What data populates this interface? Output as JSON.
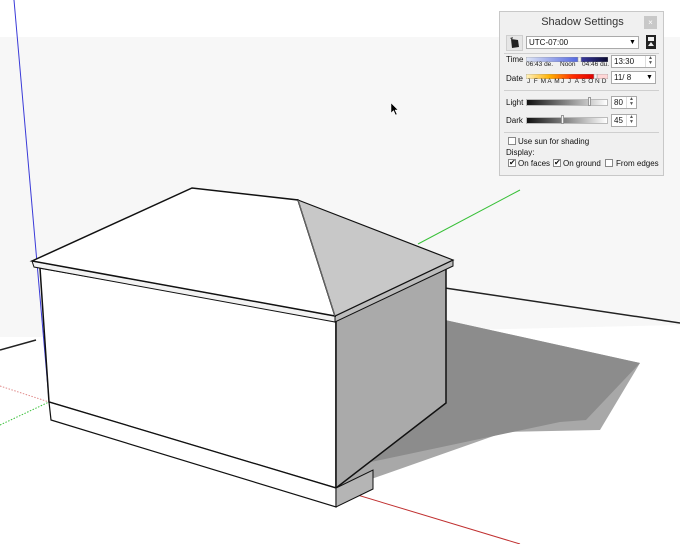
{
  "shadow_settings": {
    "title": "Shadow Settings",
    "close_icon": "collapse-icon",
    "timezone": {
      "selected": "UTC-07:00",
      "icon": "sun-shadow-toggle-icon"
    },
    "expand_icon": "expand-details-icon",
    "time": {
      "label": "Time",
      "sunrise": "06:43 de.",
      "noon": "Noon",
      "sunset": "04:46 du.",
      "value": "13:30",
      "slider_fraction": 0.68
    },
    "date": {
      "label": "Date",
      "months": [
        "J",
        "F",
        "M",
        "A",
        "M",
        "J",
        "J",
        "A",
        "S",
        "O",
        "N",
        "D"
      ],
      "value": "11/ 8",
      "slider_fraction": 0.86
    },
    "light": {
      "label": "Light",
      "value": "80",
      "slider_fraction": 0.8
    },
    "dark": {
      "label": "Dark",
      "value": "45",
      "slider_fraction": 0.45
    },
    "use_sun_for_shading": {
      "label": "Use sun for shading",
      "checked": false
    },
    "display": {
      "label": "Display:",
      "on_faces": {
        "label": "On faces",
        "checked": true
      },
      "on_ground": {
        "label": "On ground",
        "checked": true
      },
      "from_edges": {
        "label": "From edges",
        "checked": false
      }
    }
  },
  "viewport": {
    "colors": {
      "sky": "#f7f7f7",
      "ground": "#ffffff",
      "x_axis": "#b22222",
      "y_axis": "#2eb82e",
      "z_axis": "#2a2ad0",
      "shadow": "#8c8c8c",
      "shadow_light": "#a8a8a8"
    }
  }
}
